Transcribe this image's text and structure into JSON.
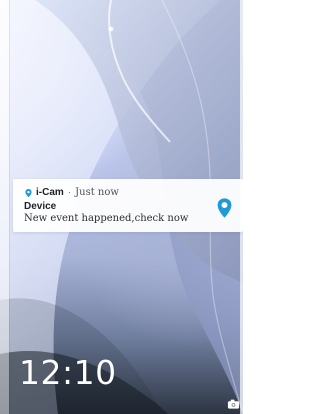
{
  "screen": {
    "name": "lock-screen"
  },
  "notification": {
    "app_icon": "location-pin-icon",
    "app_name": "i-Cam",
    "separator": "·",
    "time": "Just now",
    "title": "Device",
    "message": "New event happened,check now",
    "accent_color": "#1e9bd7"
  },
  "lockscreen": {
    "time": "12:10",
    "camera_icon": "camera-icon"
  }
}
